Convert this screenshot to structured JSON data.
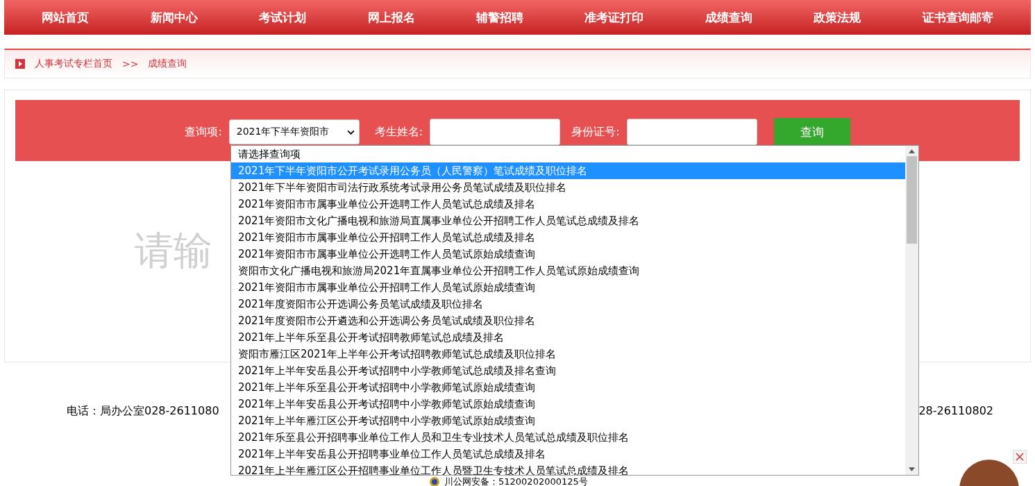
{
  "nav": {
    "items": [
      "网站首页",
      "新闻中心",
      "考试计划",
      "网上报名",
      "辅警招聘",
      "准考证打印",
      "成绩查询",
      "政策法规",
      "证书查询邮寄"
    ]
  },
  "breadcrumb": {
    "items": [
      "人事考试专栏首页",
      "成绩查询"
    ],
    "separator": ">>"
  },
  "form": {
    "query_label": "查询项:",
    "query_value": "2021年下半年资阳市",
    "name_label": "考生姓名:",
    "id_label": "身份证号:",
    "submit": "查询"
  },
  "hint": "请输",
  "dropdown": {
    "options": [
      {
        "label": "请选择查询项",
        "selected": false
      },
      {
        "label": "2021年下半年资阳市公开考试录用公务员（人民警察）笔试成绩及职位排名",
        "selected": true
      },
      {
        "label": "2021年下半年资阳市司法行政系统考试录用公务员笔试成绩及职位排名",
        "selected": false
      },
      {
        "label": "2021年资阳市市属事业单位公开选聘工作人员笔试总成绩及排名",
        "selected": false
      },
      {
        "label": "2021年资阳市文化广播电视和旅游局直属事业单位公开招聘工作人员笔试总成绩及排名",
        "selected": false
      },
      {
        "label": "2021年资阳市市属事业单位公开招聘工作人员笔试总成绩及排名",
        "selected": false
      },
      {
        "label": "2021年资阳市市属事业单位公开选聘工作人员笔试原始成绩查询",
        "selected": false
      },
      {
        "label": "资阳市文化广播电视和旅游局2021年直属事业单位公开招聘工作人员笔试原始成绩查询",
        "selected": false
      },
      {
        "label": "2021年资阳市市属事业单位公开招聘工作人员笔试原始成绩查询",
        "selected": false
      },
      {
        "label": "2021年度资阳市公开选调公务员笔试成绩及职位排名",
        "selected": false
      },
      {
        "label": "2021年度资阳市公开遴选和公开选调公务员笔试成绩及职位排名",
        "selected": false
      },
      {
        "label": "2021年上半年乐至县公开考试招聘教师笔试总成绩及排名",
        "selected": false
      },
      {
        "label": "资阳市雁江区2021年上半年公开考试招聘教师笔试总成绩及职位排名",
        "selected": false
      },
      {
        "label": "2021年上半年安岳县公开考试招聘中小学教师笔试总成绩及排名查询",
        "selected": false
      },
      {
        "label": "2021年上半年乐至县公开考试招聘中小学教师笔试原始成绩查询",
        "selected": false
      },
      {
        "label": "2021年上半年安岳县公开考试招聘中小学教师笔试原始成绩查询",
        "selected": false
      },
      {
        "label": "2021年上半年雁江区公开考试招聘中小学教师笔试原始成绩查询",
        "selected": false
      },
      {
        "label": "2021年乐至县公开招聘事业单位工作人员和卫生专业技术人员笔试总成绩及职位排名",
        "selected": false
      },
      {
        "label": "2021年上半年安岳县公开招聘事业单位工作人员笔试总成绩及排名",
        "selected": false
      },
      {
        "label": "2021年上半年雁江区公开招聘事业单位工作人员暨卫生专技术人员笔试总成绩及排名",
        "selected": false
      }
    ]
  },
  "footer": {
    "phone_left": "电话：局办公室028-2611080",
    "phone_right": "28-26110802",
    "record": "川公网安备：51200202000125号"
  }
}
